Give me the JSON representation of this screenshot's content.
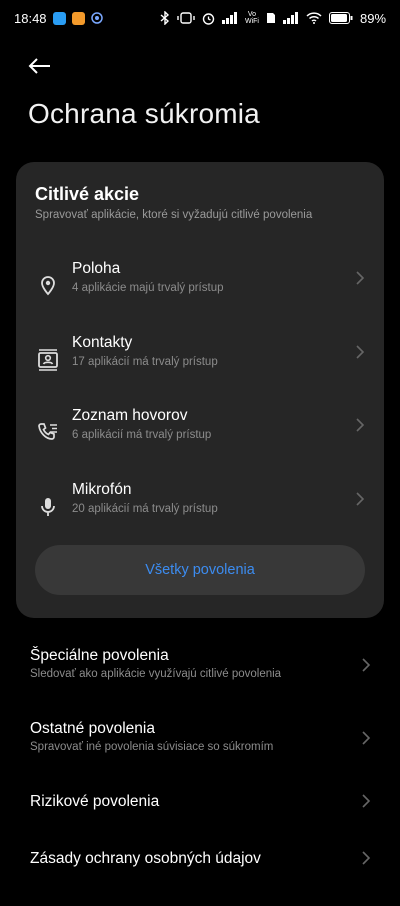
{
  "status_bar": {
    "time": "18:48",
    "battery": "89",
    "battery_unit": "%",
    "volte_top": "Vo",
    "volte_bottom": "WiFi"
  },
  "header": {
    "title": "Ochrana súkromia"
  },
  "sensitive_card": {
    "title": "Citlivé akcie",
    "subtitle": "Spravovať aplikácie, ktoré si vyžadujú citlivé povolenia",
    "items": [
      {
        "label": "Poloha",
        "sub": "4 aplikácie majú trvalý prístup",
        "icon": "location-icon"
      },
      {
        "label": "Kontakty",
        "sub": "17 aplikácií má trvalý prístup",
        "icon": "contacts-icon"
      },
      {
        "label": "Zoznam hovorov",
        "sub": "6 aplikácií má trvalý prístup",
        "icon": "call-log-icon"
      },
      {
        "label": "Mikrofón",
        "sub": "20 aplikácií má trvalý prístup",
        "icon": "microphone-icon"
      }
    ],
    "all_button": "Všetky povolenia"
  },
  "rows": [
    {
      "label": "Špeciálne povolenia",
      "sub": "Sledovať ako aplikácie využívajú citlivé povolenia"
    },
    {
      "label": "Ostatné povolenia",
      "sub": "Spravovať iné povolenia súvisiace so súkromím"
    },
    {
      "label": "Rizikové povolenia",
      "sub": ""
    },
    {
      "label": "Zásady ochrany osobných údajov",
      "sub": ""
    }
  ],
  "colors": {
    "background": "#000000",
    "card": "#262626",
    "accent": "#3c8cf0"
  }
}
